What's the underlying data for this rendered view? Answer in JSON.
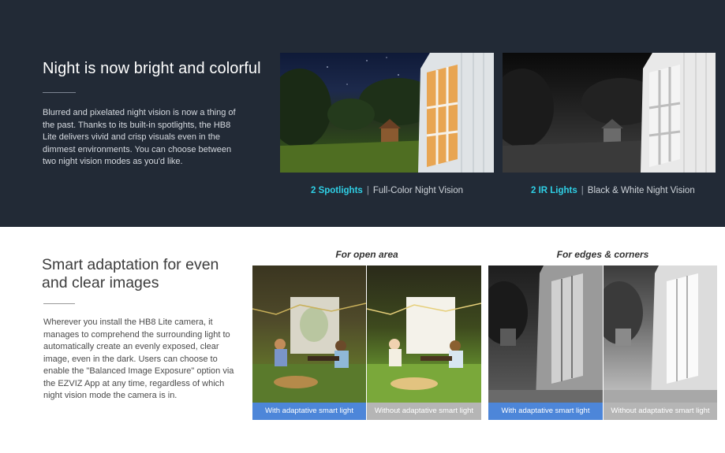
{
  "night_section": {
    "heading": "Night is now bright and colorful",
    "body": "Blurred and pixelated night vision is now a thing of the past. Thanks to its built-in spotlights, the HB8 Lite delivers vivid and crisp visuals even in the dimmest environments. You can choose between two night vision modes as you'd like.",
    "modes": [
      {
        "highlight": "2 Spotlights",
        "separator": "|",
        "label": "Full-Color Night Vision"
      },
      {
        "highlight": "2 IR Lights",
        "separator": "|",
        "label": "Black & White Night Vision"
      }
    ]
  },
  "adaptation_section": {
    "heading": "Smart adaptation for even and clear images",
    "body": "Wherever you install the HB8 Lite camera, it manages to comprehend the surrounding light to automatically create an evenly exposed, clear image, even in the dark. Users can choose to enable the \"Balanced Image Exposure\" option via the EZVIZ App at any time, regardless of which night vision mode the camera is in.",
    "groups": [
      {
        "title": "For open area",
        "with_label": "With adaptative smart light",
        "without_label": "Without adaptative smart light"
      },
      {
        "title": "For edges & corners",
        "with_label": "With adaptative smart light",
        "without_label": "Without adaptative smart light"
      }
    ]
  },
  "colors": {
    "dark_bg": "#222a36",
    "accent_cyan": "#2fd0e6",
    "tag_blue": "#4d86d9",
    "tag_gray": "#b5b5b5"
  }
}
